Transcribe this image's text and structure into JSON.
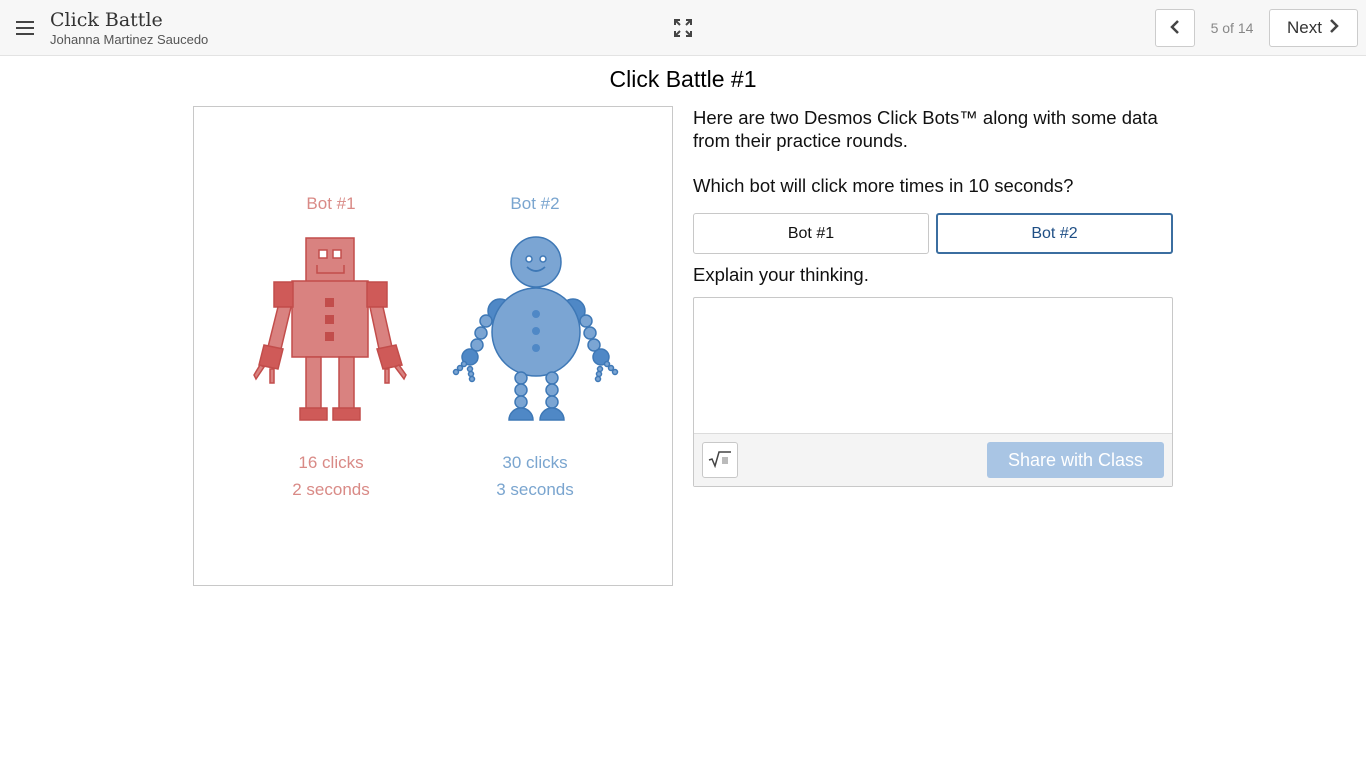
{
  "header": {
    "app_title": "Click Battle",
    "user_name": "Johanna Martinez Saucedo",
    "page_indicator": "5 of 14",
    "next_label": "Next",
    "icons": [
      "menu-icon",
      "fullscreen-icon",
      "chevron-left-icon",
      "chevron-right-icon"
    ]
  },
  "main": {
    "title": "Click Battle #1",
    "prompt_intro": "Here are two Desmos Click Bots™ along with some data from their practice rounds.",
    "question": "Which bot will click more times in 10 seconds?",
    "choices": [
      {
        "label": "Bot #1",
        "selected": false
      },
      {
        "label": "Bot #2",
        "selected": true
      }
    ],
    "explain_prompt": "Explain your thinking.",
    "answer_value": "",
    "share_label": "Share with Class"
  },
  "image": {
    "bot1": {
      "label": "Bot #1",
      "clicks": "16 clicks",
      "time": "2 seconds"
    },
    "bot2": {
      "label": "Bot #2",
      "clicks": "30 clicks",
      "time": "3 seconds"
    }
  },
  "colors": {
    "bot1_fill": "#d98280",
    "bot1_stroke": "#c24d4b",
    "bot1_text": "#d98a86",
    "bot2_fill": "#7ba5d3",
    "bot2_stroke": "#3e78b6",
    "bot2_text": "#7aa5cf",
    "accent": "#3b6ea0",
    "share_button": "#a9c5e4"
  }
}
